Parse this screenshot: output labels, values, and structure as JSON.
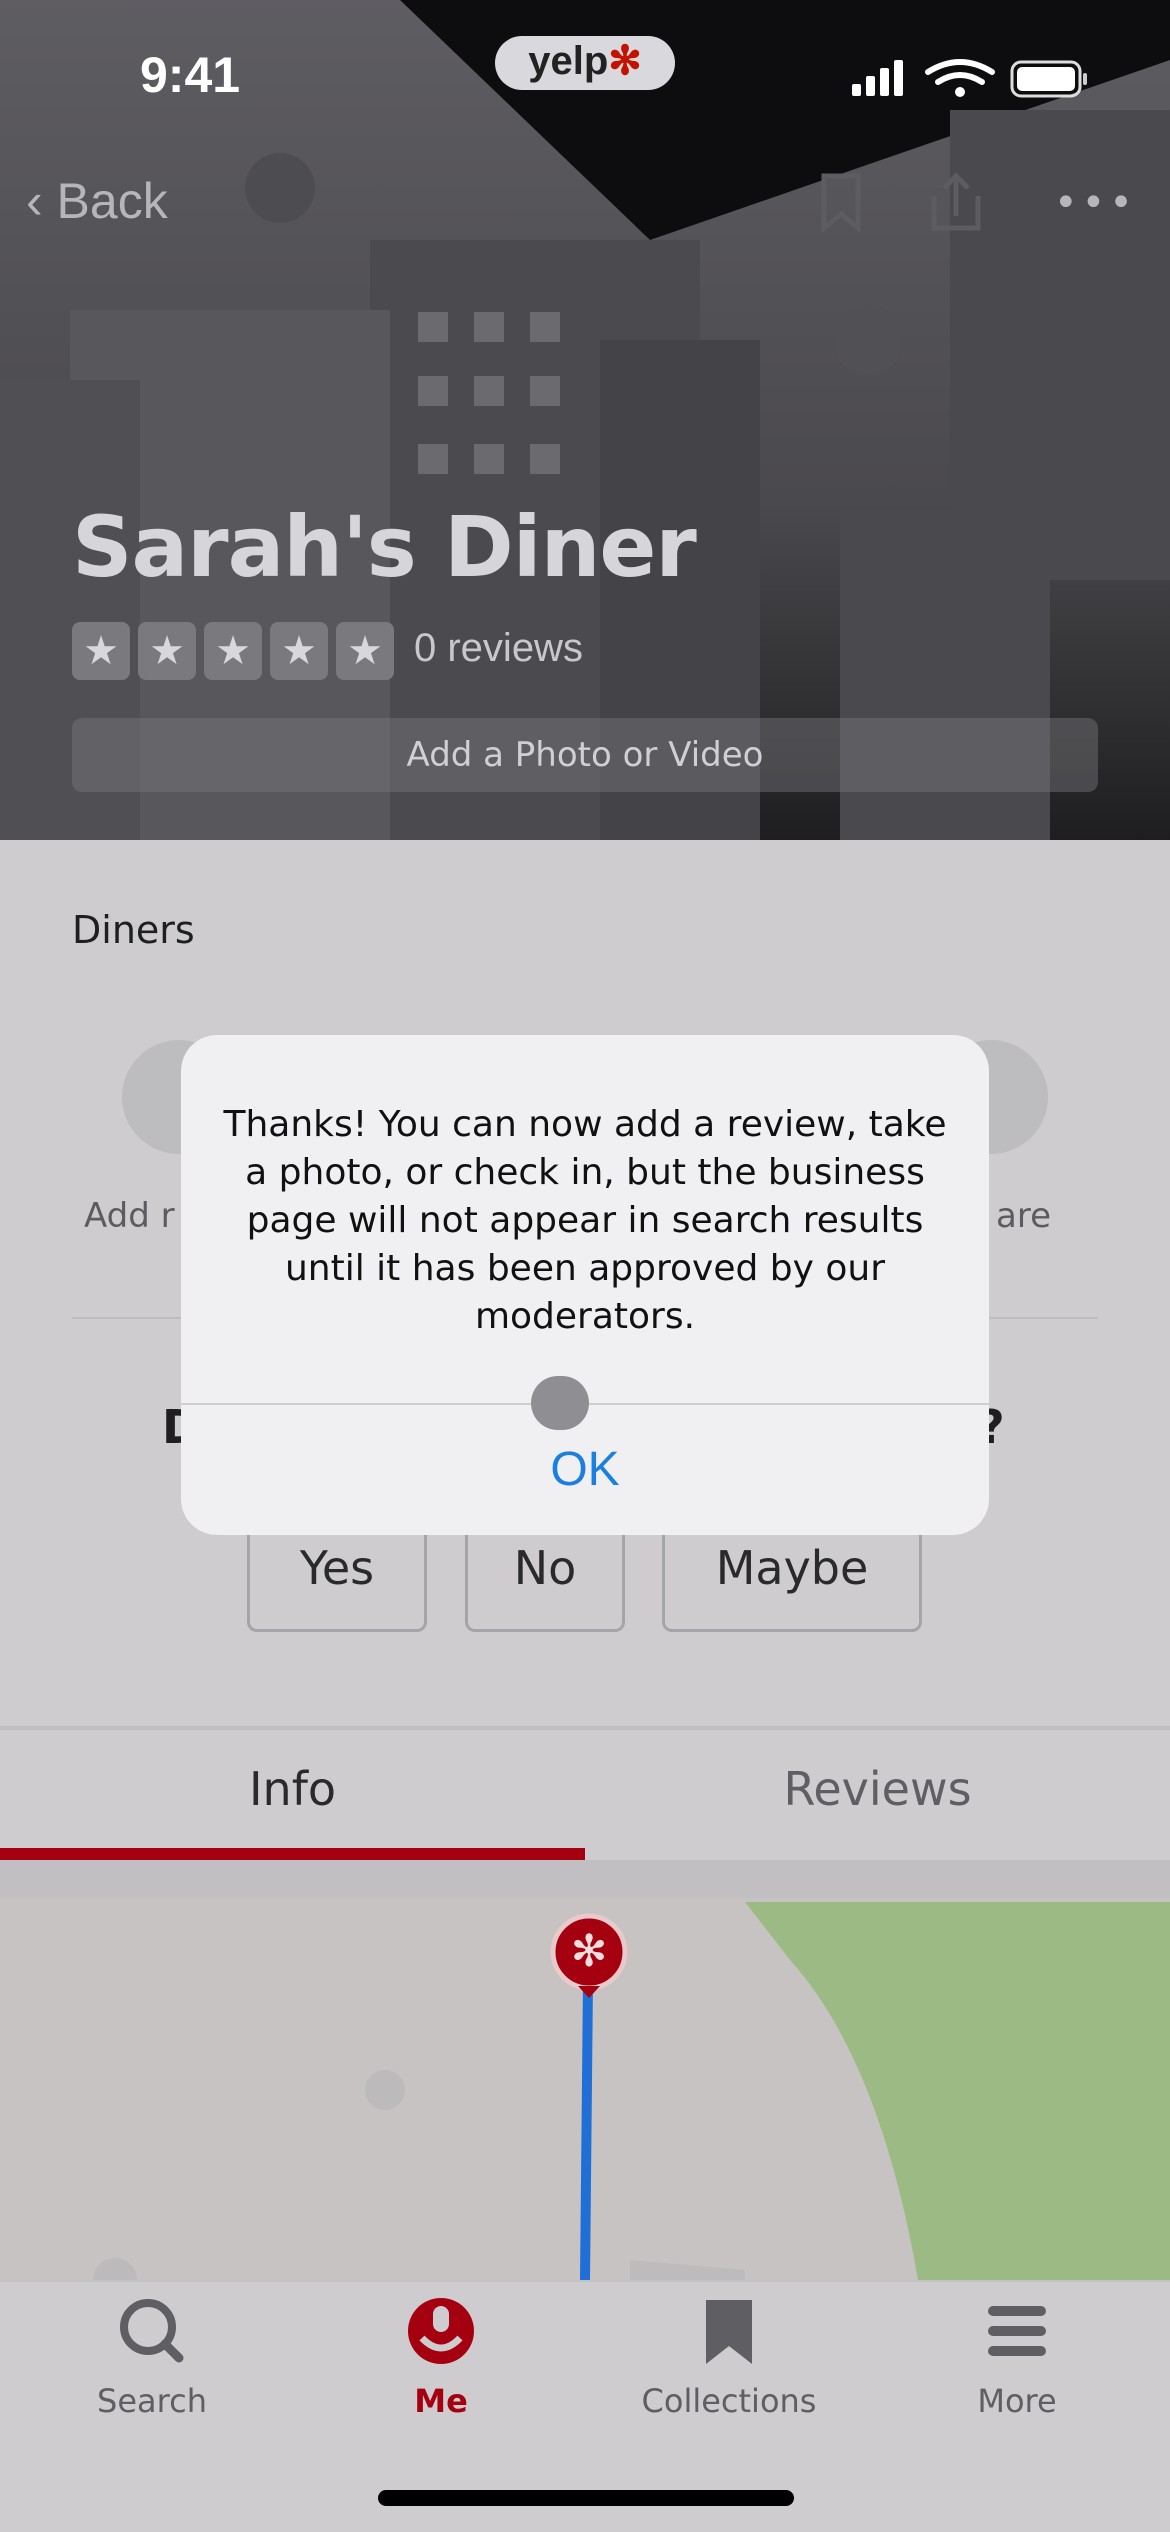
{
  "status_bar": {
    "time": "9:41",
    "app_badge": "yelp"
  },
  "nav": {
    "back_label": "Back"
  },
  "business": {
    "name": "Sarah's Diner",
    "rating_stars": 0,
    "reviews": "0 reviews",
    "add_photo": "Add a Photo or Video",
    "category": "Diners"
  },
  "actions": {
    "left_label_fragment": "Add r",
    "right_label_fragment": "are"
  },
  "question": {
    "start_fragment": "D",
    "end_fragment": "?",
    "answers": [
      "Yes",
      "No",
      "Maybe"
    ]
  },
  "tabs": [
    {
      "label": "Info",
      "active": true
    },
    {
      "label": "Reviews",
      "active": false
    }
  ],
  "tab_bar": [
    {
      "label": "Search",
      "active": false
    },
    {
      "label": "Me",
      "active": true
    },
    {
      "label": "Collections",
      "active": false
    },
    {
      "label": "More",
      "active": false
    }
  ],
  "dialog": {
    "message": "Thanks! You can now add a review, take a photo, or check in, but the business page will not appear in search results until it has been approved by our moderators.",
    "ok_label": "OK"
  },
  "colors": {
    "brand_red": "#a50010",
    "link_blue": "#1a7fe0",
    "route_blue": "#1f6fd6",
    "park_green": "#9cbb84"
  }
}
